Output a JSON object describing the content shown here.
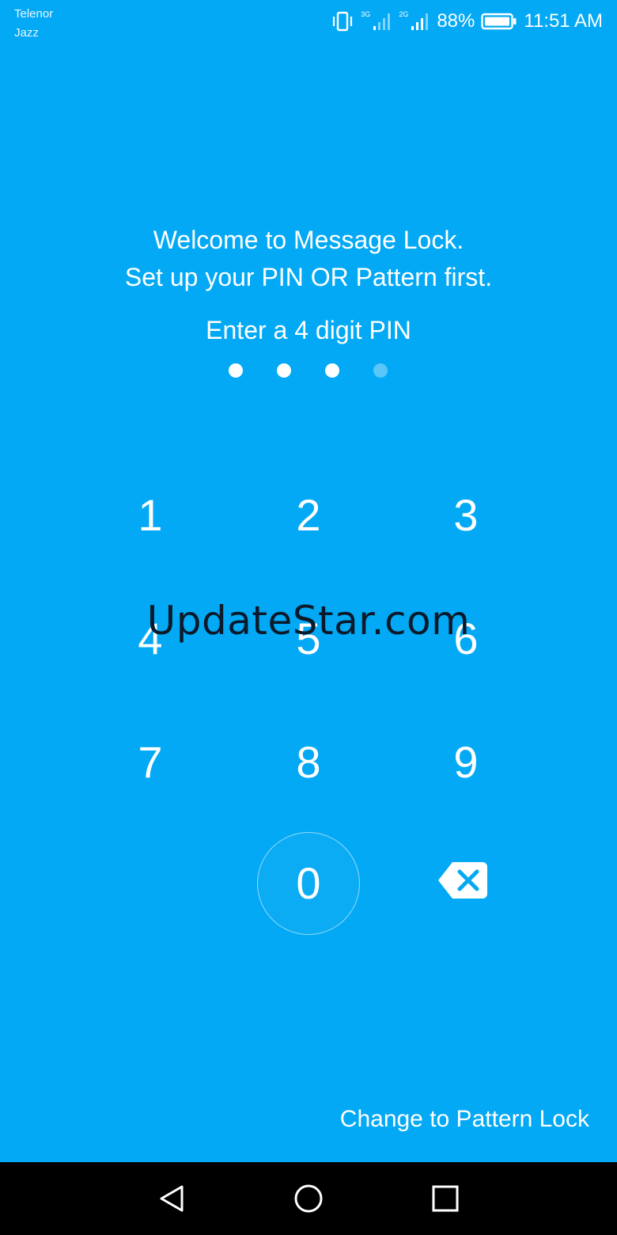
{
  "status_bar": {
    "carrier_line1": "Telenor",
    "carrier_line2": "Jazz",
    "network1": "3G",
    "network2": "2G",
    "battery_percent": "88%",
    "time": "11:51 AM",
    "icons": [
      "vibrate-icon",
      "signal-icon",
      "signal-icon",
      "battery-icon"
    ]
  },
  "welcome": {
    "line1": "Welcome to Message Lock.",
    "line2": "Set up your PIN OR Pattern first."
  },
  "prompt": "Enter a 4 digit PIN",
  "pin": {
    "length": 4,
    "filled": 3
  },
  "keypad": {
    "k1": "1",
    "k2": "2",
    "k3": "3",
    "k4": "4",
    "k5": "5",
    "k6": "6",
    "k7": "7",
    "k8": "8",
    "k9": "9",
    "k0": "0",
    "backspace_icon": "backspace-icon"
  },
  "watermark": "UpdateStar.com",
  "pattern_link": "Change to Pattern Lock",
  "nav": {
    "back_icon": "back-icon",
    "home_icon": "home-icon",
    "recents_icon": "recents-icon"
  },
  "colors": {
    "background": "#03A9F4",
    "nav_bar": "#000000",
    "text": "#FFFFFF"
  }
}
